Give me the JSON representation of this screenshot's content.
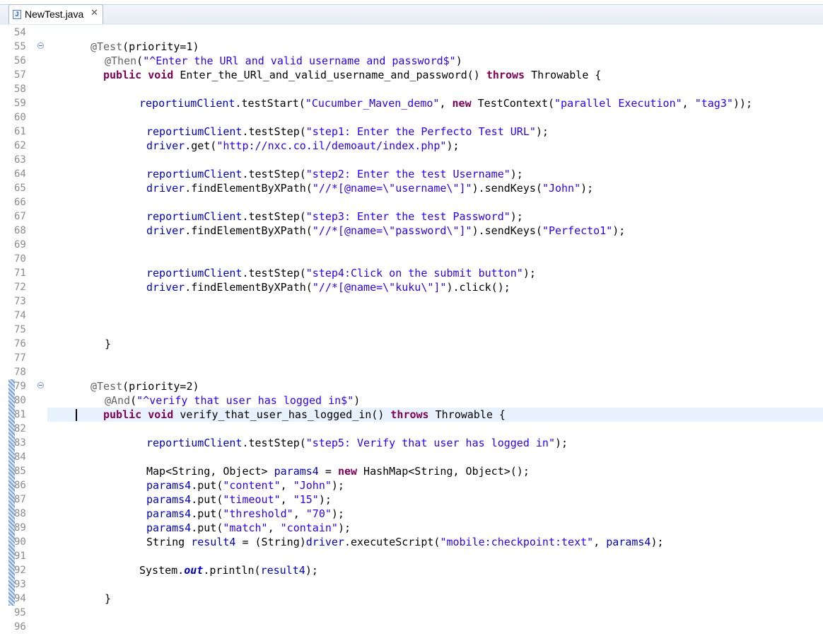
{
  "tab": {
    "label": "NewTest.java",
    "icon": "java-file-icon",
    "close": "✕"
  },
  "lines": [
    {
      "n": "54",
      "indent": 0,
      "tokens": []
    },
    {
      "n": "55",
      "indent": 128,
      "fold": true,
      "tokens": [
        [
          "a",
          "@Test"
        ],
        [
          "p",
          "(priority=1)"
        ]
      ]
    },
    {
      "n": "56",
      "indent": 148,
      "tokens": [
        [
          "a",
          "@Then"
        ],
        [
          "p",
          "("
        ],
        [
          "s",
          "\"^Enter the URl and valid username and password$\""
        ],
        [
          "p",
          ")"
        ]
      ]
    },
    {
      "n": "57",
      "indent": 146,
      "tokens": [
        [
          "k",
          "public"
        ],
        [
          "p",
          " "
        ],
        [
          "k",
          "void"
        ],
        [
          "p",
          " Enter_the_URl_and_valid_username_and_password() "
        ],
        [
          "k",
          "throws"
        ],
        [
          "p",
          " Throwable {"
        ]
      ]
    },
    {
      "n": "58",
      "indent": 0,
      "tokens": []
    },
    {
      "n": "59",
      "indent": 197,
      "tokens": [
        [
          "f",
          "reportiumClient"
        ],
        [
          "p",
          ".testStart("
        ],
        [
          "s",
          "\"Cucumber_Maven_demo\""
        ],
        [
          "p",
          ", "
        ],
        [
          "k",
          "new"
        ],
        [
          "p",
          " TestContext("
        ],
        [
          "s",
          "\"parallel Execution\""
        ],
        [
          "p",
          ", "
        ],
        [
          "s",
          "\"tag3\""
        ],
        [
          "p",
          "));"
        ]
      ]
    },
    {
      "n": "60",
      "indent": 0,
      "tokens": []
    },
    {
      "n": "61",
      "indent": 207,
      "tokens": [
        [
          "f",
          "reportiumClient"
        ],
        [
          "p",
          ".testStep("
        ],
        [
          "s",
          "\"step1: Enter the Perfecto Test URL\""
        ],
        [
          "p",
          ");"
        ]
      ]
    },
    {
      "n": "62",
      "indent": 207,
      "tokens": [
        [
          "f",
          "driver"
        ],
        [
          "p",
          ".get("
        ],
        [
          "s",
          "\"http://nxc.co.il/demoaut/index.php\""
        ],
        [
          "p",
          ");"
        ]
      ]
    },
    {
      "n": "63",
      "indent": 0,
      "tokens": []
    },
    {
      "n": "64",
      "indent": 207,
      "tokens": [
        [
          "f",
          "reportiumClient"
        ],
        [
          "p",
          ".testStep("
        ],
        [
          "s",
          "\"step2: Enter the test Username\""
        ],
        [
          "p",
          ");"
        ]
      ]
    },
    {
      "n": "65",
      "indent": 207,
      "tokens": [
        [
          "f",
          "driver"
        ],
        [
          "p",
          ".findElementByXPath("
        ],
        [
          "s",
          "\"//*[@name=\\\"username\\\"]\""
        ],
        [
          "p",
          ").sendKeys("
        ],
        [
          "s",
          "\"John\""
        ],
        [
          "p",
          ");"
        ]
      ]
    },
    {
      "n": "66",
      "indent": 0,
      "tokens": []
    },
    {
      "n": "67",
      "indent": 207,
      "tokens": [
        [
          "f",
          "reportiumClient"
        ],
        [
          "p",
          ".testStep("
        ],
        [
          "s",
          "\"step3: Enter the test Password\""
        ],
        [
          "p",
          ");"
        ]
      ]
    },
    {
      "n": "68",
      "indent": 207,
      "tokens": [
        [
          "f",
          "driver"
        ],
        [
          "p",
          ".findElementByXPath("
        ],
        [
          "s",
          "\"//*[@name=\\\"password\\\"]\""
        ],
        [
          "p",
          ").sendKeys("
        ],
        [
          "s",
          "\"Perfecto1\""
        ],
        [
          "p",
          ");"
        ]
      ]
    },
    {
      "n": "69",
      "indent": 0,
      "tokens": []
    },
    {
      "n": "70",
      "indent": 0,
      "tokens": []
    },
    {
      "n": "71",
      "indent": 207,
      "tokens": [
        [
          "f",
          "reportiumClient"
        ],
        [
          "p",
          ".testStep("
        ],
        [
          "s",
          "\"step4:Click on the submit button\""
        ],
        [
          "p",
          ");"
        ]
      ]
    },
    {
      "n": "72",
      "indent": 207,
      "tokens": [
        [
          "f",
          "driver"
        ],
        [
          "p",
          ".findElementByXPath("
        ],
        [
          "s",
          "\"//*[@name=\\\"kuku\\\"]\""
        ],
        [
          "p",
          ").click();"
        ]
      ]
    },
    {
      "n": "73",
      "indent": 0,
      "tokens": []
    },
    {
      "n": "74",
      "indent": 0,
      "tokens": []
    },
    {
      "n": "75",
      "indent": 0,
      "tokens": []
    },
    {
      "n": "76",
      "indent": 148,
      "tokens": [
        [
          "p",
          "}"
        ]
      ]
    },
    {
      "n": "77",
      "indent": 0,
      "tokens": []
    },
    {
      "n": "78",
      "indent": 0,
      "tokens": []
    },
    {
      "n": "79",
      "indent": 128,
      "fold": true,
      "tokens": [
        [
          "a",
          "@Test"
        ],
        [
          "p",
          "(priority=2)"
        ]
      ]
    },
    {
      "n": "80",
      "indent": 148,
      "tokens": [
        [
          "a",
          "@And"
        ],
        [
          "p",
          "("
        ],
        [
          "s",
          "\"^verify that user has logged in$\""
        ],
        [
          "p",
          ")"
        ]
      ]
    },
    {
      "n": "81",
      "indent": 146,
      "current": true,
      "tokens": [
        [
          "k",
          "public"
        ],
        [
          "p",
          " "
        ],
        [
          "k",
          "void"
        ],
        [
          "p",
          " verify_that_user_has_logged_in() "
        ],
        [
          "k",
          "throws"
        ],
        [
          "p",
          " Throwable {"
        ]
      ]
    },
    {
      "n": "82",
      "indent": 0,
      "tokens": []
    },
    {
      "n": "83",
      "indent": 207,
      "tokens": [
        [
          "f",
          "reportiumClient"
        ],
        [
          "p",
          ".testStep("
        ],
        [
          "s",
          "\"step5: Verify that user has logged in\""
        ],
        [
          "p",
          ");"
        ]
      ]
    },
    {
      "n": "84",
      "indent": 0,
      "tokens": []
    },
    {
      "n": "85",
      "indent": 207,
      "tokens": [
        [
          "p",
          "Map<String, Object> "
        ],
        [
          "f",
          "params4"
        ],
        [
          "p",
          " = "
        ],
        [
          "k",
          "new"
        ],
        [
          "p",
          " HashMap<String, Object>();"
        ]
      ]
    },
    {
      "n": "86",
      "indent": 207,
      "tokens": [
        [
          "f",
          "params4"
        ],
        [
          "p",
          ".put("
        ],
        [
          "s",
          "\"content\""
        ],
        [
          "p",
          ", "
        ],
        [
          "s",
          "\"John\""
        ],
        [
          "p",
          ");"
        ]
      ]
    },
    {
      "n": "87",
      "indent": 207,
      "tokens": [
        [
          "f",
          "params4"
        ],
        [
          "p",
          ".put("
        ],
        [
          "s",
          "\"timeout\""
        ],
        [
          "p",
          ", "
        ],
        [
          "s",
          "\"15\""
        ],
        [
          "p",
          ");"
        ]
      ]
    },
    {
      "n": "88",
      "indent": 207,
      "tokens": [
        [
          "f",
          "params4"
        ],
        [
          "p",
          ".put("
        ],
        [
          "s",
          "\"threshold\""
        ],
        [
          "p",
          ", "
        ],
        [
          "s",
          "\"70\""
        ],
        [
          "p",
          ");"
        ]
      ]
    },
    {
      "n": "89",
      "indent": 207,
      "tokens": [
        [
          "f",
          "params4"
        ],
        [
          "p",
          ".put("
        ],
        [
          "s",
          "\"match\""
        ],
        [
          "p",
          ", "
        ],
        [
          "s",
          "\"contain\""
        ],
        [
          "p",
          ");"
        ]
      ]
    },
    {
      "n": "90",
      "indent": 207,
      "tokens": [
        [
          "p",
          "String "
        ],
        [
          "f",
          "result4"
        ],
        [
          "p",
          " = (String)"
        ],
        [
          "f",
          "driver"
        ],
        [
          "p",
          ".executeScript("
        ],
        [
          "s",
          "\"mobile:checkpoint:text\""
        ],
        [
          "p",
          ", "
        ],
        [
          "f",
          "params4"
        ],
        [
          "p",
          ");"
        ]
      ]
    },
    {
      "n": "91",
      "indent": 0,
      "tokens": []
    },
    {
      "n": "92",
      "indent": 197,
      "tokens": [
        [
          "p",
          "System."
        ],
        [
          "fi",
          "out"
        ],
        [
          "p",
          ".println("
        ],
        [
          "f",
          "result4"
        ],
        [
          "p",
          ");"
        ]
      ]
    },
    {
      "n": "93",
      "indent": 0,
      "tokens": []
    },
    {
      "n": "94",
      "indent": 148,
      "tokens": [
        [
          "p",
          "}"
        ]
      ]
    },
    {
      "n": "95",
      "indent": 0,
      "tokens": []
    },
    {
      "n": "96",
      "indent": 0,
      "tokens": []
    }
  ]
}
